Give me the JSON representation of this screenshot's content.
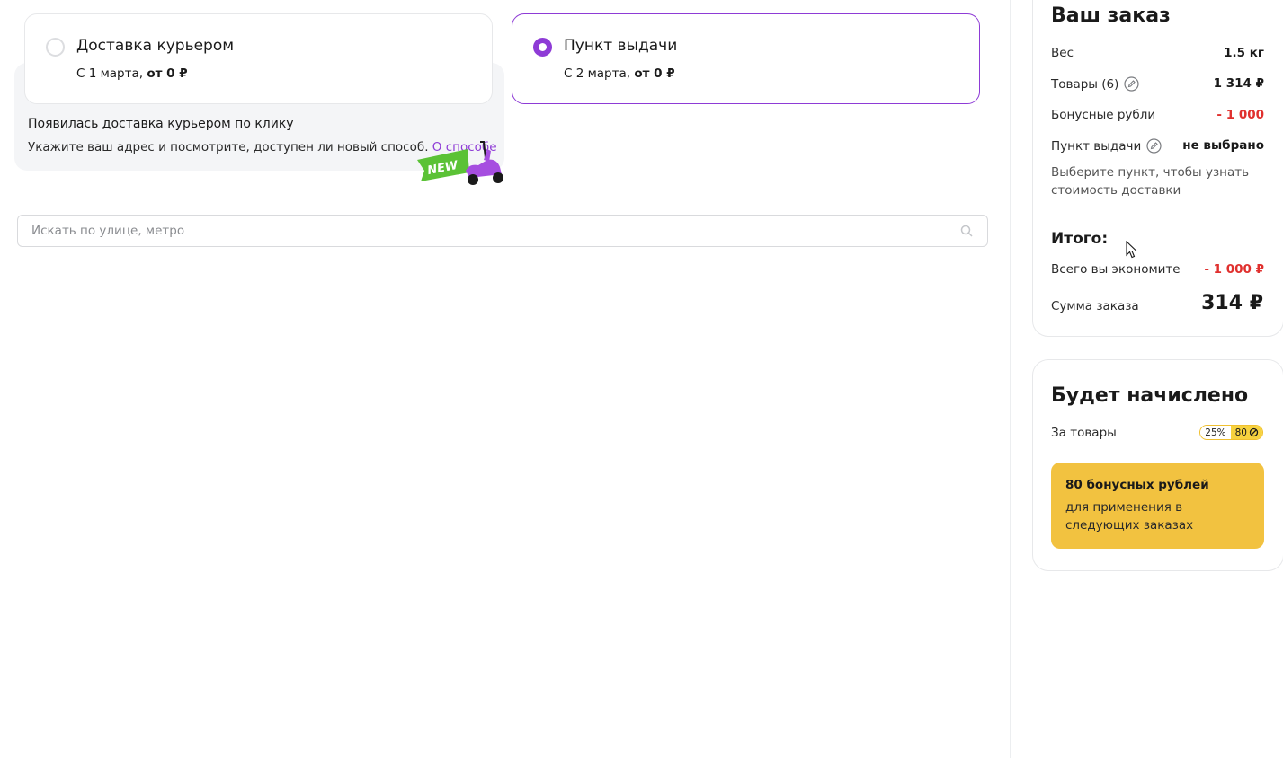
{
  "delivery": {
    "courier": {
      "title": "Доставка курьером",
      "date": "С 1 марта,",
      "price": "от 0 ₽",
      "selected": false
    },
    "pickup": {
      "title": "Пункт выдачи",
      "date": "С 2 марта,",
      "price": "от 0 ₽",
      "selected": true
    }
  },
  "banner": {
    "title": "Появилась доставка курьером по клику",
    "text": "Укажите ваш адрес и посмотрите, доступен ли новый способ.",
    "link": "О способе",
    "badge": "NEW"
  },
  "search": {
    "placeholder": "Искать по улице, метро",
    "value": ""
  },
  "summary": {
    "title": "Ваш заказ",
    "weight_label": "Вес",
    "weight_value": "1.5 кг",
    "goods_label": "Товары (6)",
    "goods_value": "1 314 ₽",
    "bonus_label": "Бонусные рубли",
    "bonus_value": "- 1 000",
    "pickup_label": "Пункт выдачи",
    "pickup_value": "не выбрано",
    "hint": "Выберите пункт, чтобы узнать стоимость доставки",
    "total_title": "Итого:",
    "savings_label": "Всего вы экономите",
    "savings_value": "- 1 000 ₽",
    "sum_label": "Сумма заказа",
    "sum_value": "314 ₽"
  },
  "bonus": {
    "title": "Будет начислено",
    "goods_label": "За товары",
    "percent": "25%",
    "amount": "80",
    "box_title": "80 бонусных рублей",
    "box_text": "для применения в следующих заказах"
  },
  "colors": {
    "accent": "#8e3bd6",
    "red": "#e0302e",
    "yellow": "#f2c240",
    "badge_green": "#5bc236"
  }
}
